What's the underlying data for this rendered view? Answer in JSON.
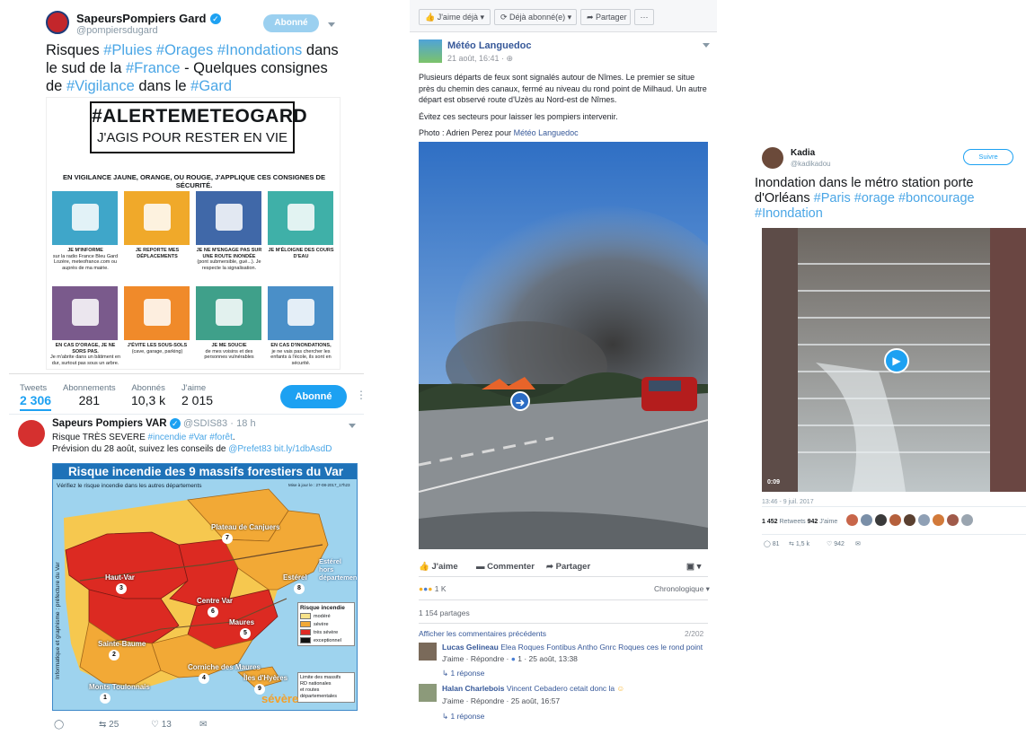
{
  "tweet_gard": {
    "name": "SapeursPompiers Gard",
    "handle": "@pompiersdugard",
    "follow_label": "Abonné",
    "text_parts": [
      "Risques ",
      "#Pluies",
      " ",
      "#Orages",
      " ",
      "#Inondations",
      " dans le sud de la ",
      "#France",
      " - Quelques consignes de ",
      "#Vigilance",
      " dans le ",
      "#Gard"
    ],
    "poster": {
      "headline": "#ALERTEMETEOGARD",
      "subheadline": "J'AGIS POUR RESTER EN VIE",
      "intro": "EN VIGILANCE JAUNE, ORANGE, OU ROUGE, J'APPLIQUE CES CONSIGNES DE SÉCURITÉ.",
      "tiles": [
        {
          "label": "JE M'INFORME",
          "sub": "sur la radio France Bleu Gard Lozère, meteofrance.com ou auprès de ma mairie.",
          "icon": "radio-icon",
          "color": "#3fa6c9"
        },
        {
          "label": "JE REPORTE MES DÉPLACEMENTS",
          "sub": "",
          "icon": "car-icon",
          "color": "#f0a92a"
        },
        {
          "label": "JE NE M'ENGAGE PAS SUR UNE ROUTE INONDÉE",
          "sub": "(pont submersible, gué...). Je respecte la signalisation.",
          "icon": "warning-sign-icon",
          "color": "#4068a8"
        },
        {
          "label": "JE M'ÉLOIGNE DES COURS D'EAU",
          "sub": "",
          "icon": "running-person-icon",
          "color": "#3fb0a8"
        },
        {
          "label": "EN CAS D'ORAGE, JE NE SORS PAS.",
          "sub": "Je m'abrite dans un bâtiment en dur, surtout pas sous un arbre.",
          "icon": "storm-tree-icon",
          "color": "#7a5a8c"
        },
        {
          "label": "J'ÉVITE LES SOUS-SOLS",
          "sub": "(cave, garage, parking)",
          "icon": "stairs-icon",
          "color": "#f08a2a"
        },
        {
          "label": "JE ME SOUCIE",
          "sub": "de mes voisins et des personnes vulnérables",
          "icon": "phone-person-icon",
          "color": "#3fa08a"
        },
        {
          "label": "EN CAS D'INONDATIONS,",
          "sub": "je ne vais pas chercher les enfants à l'école, ils sont en sécurité.",
          "icon": "school-icon",
          "color": "#4a8fc8"
        }
      ]
    }
  },
  "profile_stats": {
    "items": [
      {
        "label": "Tweets",
        "value": "2 306"
      },
      {
        "label": "Abonnements",
        "value": "281"
      },
      {
        "label": "Abonnés",
        "value": "10,3 k"
      },
      {
        "label": "J'aime",
        "value": "2 015"
      }
    ],
    "follow_label": "Abonné"
  },
  "tweet_var": {
    "name": "Sapeurs Pompiers VAR",
    "handle": "@SDIS83",
    "time": "18 h",
    "line1_parts": [
      "Risque TRÈS SEVERE ",
      "#incendie",
      " ",
      "#Var",
      " ",
      "#forêt",
      "."
    ],
    "line2_parts": [
      "Prévision du 28 août, suivez les conseils de ",
      "@Prefet83",
      " ",
      "bit.ly/1dbAsdD"
    ],
    "map": {
      "title": "Risque incendie des 9 massifs forestiers du Var",
      "subtitle": "Vérifiez le risque incendie dans les autres départements",
      "updated": "Mise à jour le : 27-08-2017_17h23",
      "side_text": "Informatique et graphisme : préfecture du Var",
      "regions": [
        {
          "name": "Haut-Var",
          "num": "3",
          "level": "très sévère"
        },
        {
          "name": "Plateau de Canjuers",
          "num": "7",
          "level": "sévère"
        },
        {
          "name": "Centre Var",
          "num": "6",
          "level": "très sévère"
        },
        {
          "name": "Estérel",
          "num": "8",
          "level": "sévère"
        },
        {
          "name": "Sainte-Baume",
          "num": "2",
          "level": "très sévère"
        },
        {
          "name": "Maures",
          "num": "5",
          "level": "très sévère"
        },
        {
          "name": "Monts Toulonnais",
          "num": "1",
          "level": "sévère"
        },
        {
          "name": "Corniche des Maures",
          "num": "4",
          "level": "sévère"
        },
        {
          "name": "Îles d'Hyères",
          "num": "9",
          "level": "sévère"
        }
      ],
      "outside_label": "Estérel hors département",
      "legend_title": "Risque incendie",
      "legend": [
        {
          "label": "modéré",
          "color": "#f7e38a"
        },
        {
          "label": "sévère",
          "color": "#f2a936"
        },
        {
          "label": "très sévère",
          "color": "#e02a24"
        },
        {
          "label": "exceptionnel",
          "color": "#111111"
        }
      ],
      "legend2": [
        "Limite des massifs",
        "RD nationales",
        "et routes départementales"
      ],
      "island_level": "sévère"
    },
    "actions": {
      "retweets": "25",
      "likes": "13"
    }
  },
  "facebook": {
    "top_buttons": [
      "J'aime déjà",
      "Déjà abonné(e)",
      "Partager",
      "···"
    ],
    "page_name": "Météo Languedoc",
    "time": "21 août, 16:41",
    "paragraphs": [
      "Plusieurs départs de feux sont signalés autour de Nîmes. Le premier se situe près du chemin des canaux, fermé au niveau du rond point de Milhaud. Un autre départ est observé route d'Uzès au Nord-est de Nîmes.",
      "Évitez ces secteurs pour laisser les pompiers intervenir."
    ],
    "photo_credit_prefix": "Photo : Adrien Perez pour ",
    "photo_credit_link": "Météo Languedoc",
    "actions": [
      "J'aime",
      "Commenter",
      "Partager"
    ],
    "reactions_count": "1 K",
    "sort_label": "Chronologique",
    "shares": "1 154 partages",
    "prev_comments": "Afficher les commentaires précédents",
    "comments_count": "2/202",
    "comments": [
      {
        "author": "Lucas Gelineau",
        "text": "Elea Roques Fontibus Antho Gnrc Roques ces le rond point",
        "meta_prefix": "J'aime · Répondre · ",
        "meta_count": "1",
        "meta_suffix": " · 25 août, 13:38",
        "replies": "1 réponse"
      },
      {
        "author": "Halan Charlebois",
        "text": "Vincent Cebadero cetait donc la",
        "meta": "J'aime · Répondre · 25 août, 16:57",
        "replies": "1 réponse"
      }
    ]
  },
  "tweet_kadia": {
    "name": "Kadia",
    "handle": "@kadikadou",
    "follow_label": "Suivre",
    "text_parts": [
      "Inondation dans le métro station porte d'Orléans ",
      "#Paris",
      " ",
      "#orage",
      " ",
      "#boncourage",
      " ",
      "#Inondation"
    ],
    "video_time": "0:09",
    "date": "13:46 - 9 juil. 2017",
    "retweets": "1 452",
    "retweets_label": "Retweets",
    "likes": "942",
    "likes_label": "J'aime",
    "actions": {
      "replies": "81",
      "retweets": "1,5 k",
      "likes": "942"
    }
  }
}
